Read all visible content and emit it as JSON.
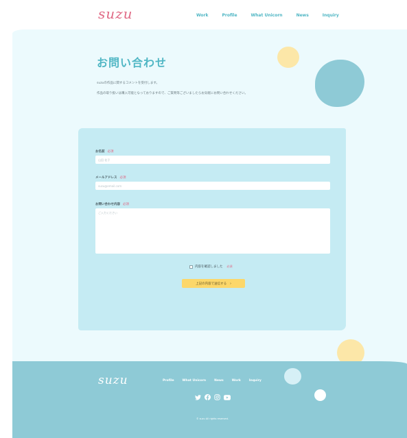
{
  "header": {
    "logo": "suzu",
    "nav": [
      "Work",
      "Profile",
      "What Unicorn",
      "News",
      "Inquiry"
    ]
  },
  "main": {
    "title": "お問い合わせ",
    "description_1": "suzuの作品に関するコメントを受付します。",
    "description_2": "作品の取り扱いは購入可能となっておりますので、ご質問等ございましたらお気軽にお問い合わせください。"
  },
  "form": {
    "name_label": "お名前",
    "name_placeholder": "山田 花子",
    "email_label": "メールアドレス",
    "email_placeholder": "suzu@email.com",
    "message_label": "お問い合わせ内容",
    "message_placeholder": "ご入力ください",
    "required": "必須",
    "confirm_label": "内容を確認しました",
    "submit_label": "上記の内容で送信する",
    "submit_arrow": "›"
  },
  "footer": {
    "logo": "suzu",
    "nav": [
      "Profile",
      "What Unicorn",
      "News",
      "Work",
      "Inquiry"
    ],
    "copyright": "© suzu All rights reserved."
  },
  "colors": {
    "accent": "#4fb6c4",
    "pink": "#e06a86",
    "yellow": "#fcd76a",
    "light_bg": "#ecfafd",
    "card_bg": "#c5ebf3",
    "footer_bg": "#8ecad6"
  },
  "icons": {
    "social": [
      "twitter-icon",
      "facebook-icon",
      "instagram-icon",
      "youtube-icon"
    ]
  }
}
